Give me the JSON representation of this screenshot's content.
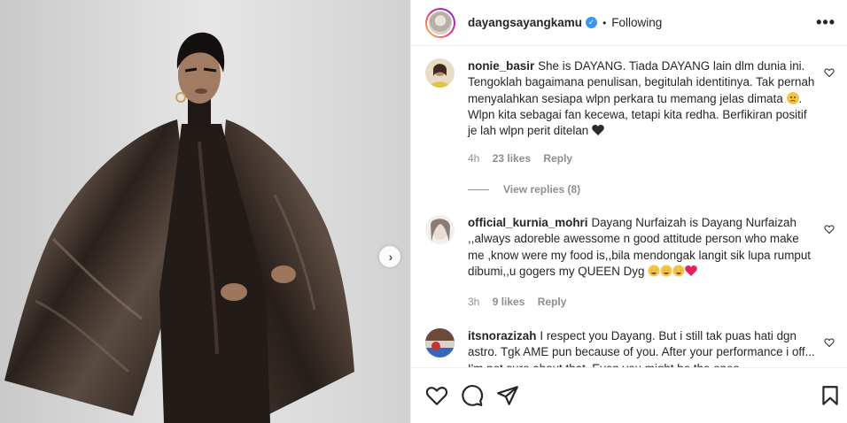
{
  "post": {
    "username": "dayangsayangkamu",
    "separator": "•",
    "follow_status": "Following",
    "more": "•••",
    "next": "›"
  },
  "comments": [
    {
      "username": "nonie_basir",
      "text_1": "She is DAYANG. Tiada DAYANG lain dlm dunia ini. Tengoklah bagaimana penulisan, begitulah identitinya. Tak pernah menyalahkan sesiapa wlpn perkara tu memang jelas dimata",
      "text_2": ". Wlpn kita sebagai fan kecewa, tetapi kita redha. Berfikiran positif je lah wlpn perit ditelan",
      "time": "4h",
      "likes": "23 likes",
      "reply": "Reply",
      "view_replies": "View replies (8)"
    },
    {
      "username": "official_kurnia_mohri",
      "text_1": "Dayang Nurfaizah is Dayang Nurfaizah ,,always adoreble awessome n good attitude person who make me ,know were my food is,,bila mendongak langit sik lupa rumput dibumi,,u gogers my QUEEN Dyg",
      "time": "3h",
      "likes": "9 likes",
      "reply": "Reply"
    },
    {
      "username": "itsnorazizah",
      "text_1": "I respect you Dayang. But i still tak puas hati dgn astro. Tgk AME pun because of you. After your performance i off... I'm not sure about that. Even you might be the ones",
      "time": "",
      "likes": "",
      "reply": ""
    }
  ],
  "icons": {
    "like": "heart-icon",
    "comment": "comment-icon",
    "share": "paper-plane-icon",
    "save": "bookmark-icon"
  },
  "colors": {
    "verified": "#3897f0",
    "muted": "#8e8e8e",
    "text": "#262626"
  }
}
